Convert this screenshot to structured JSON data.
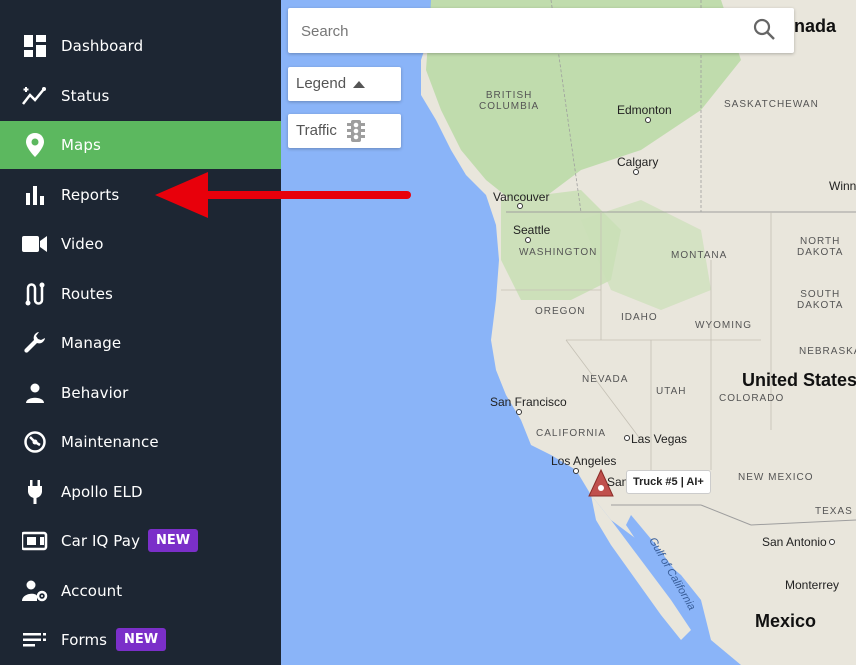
{
  "sidebar": {
    "items": [
      {
        "label": "Dashboard",
        "icon": "dashboard-icon",
        "active": false
      },
      {
        "label": "Status",
        "icon": "status-icon",
        "active": false
      },
      {
        "label": "Maps",
        "icon": "map-pin-icon",
        "active": true
      },
      {
        "label": "Reports",
        "icon": "bar-chart-icon",
        "active": false
      },
      {
        "label": "Video",
        "icon": "video-camera-icon",
        "active": false
      },
      {
        "label": "Routes",
        "icon": "routes-icon",
        "active": false
      },
      {
        "label": "Manage",
        "icon": "wrench-icon",
        "active": false
      },
      {
        "label": "Behavior",
        "icon": "person-icon",
        "active": false
      },
      {
        "label": "Maintenance",
        "icon": "maintenance-icon",
        "active": false
      },
      {
        "label": "Apollo ELD",
        "icon": "plug-icon",
        "active": false
      },
      {
        "label": "Car IQ Pay",
        "icon": "payment-icon",
        "active": false,
        "badge": "NEW"
      },
      {
        "label": "Account",
        "icon": "account-settings-icon",
        "active": false
      },
      {
        "label": "Forms",
        "icon": "forms-icon",
        "active": false,
        "badge": "NEW"
      }
    ]
  },
  "map": {
    "search_placeholder": "Search",
    "legend_label": "Legend",
    "traffic_label": "Traffic",
    "truck_label": "Truck #5 | AI+",
    "labels": {
      "canada": "nada",
      "british_columbia": "BRITISH\nCOLUMBIA",
      "edmonton": "Edmonton",
      "saskatchewan": "SASKATCHEWAN",
      "calgary": "Calgary",
      "winnipeg": "Winn",
      "vancouver": "Vancouver",
      "seattle": "Seattle",
      "washington": "WASHINGTON",
      "montana": "MONTANA",
      "north_dakota": "NORTH\nDAKOTA",
      "south_dakota": "SOUTH\nDAKOTA",
      "oregon": "OREGON",
      "idaho": "IDAHO",
      "wyoming": "WYOMING",
      "nebraska": "NEBRASKA",
      "nevada": "NEVADA",
      "utah": "UTAH",
      "united_states": "United States",
      "san_francisco": "San Francisco",
      "colorado": "COLORADO",
      "california": "CALIFORNIA",
      "las_vegas": "Las Vegas",
      "los_angeles": "Los Angeles",
      "san_diego": "San",
      "new_mexico": "NEW MEXICO",
      "texas": "TEXAS",
      "san_antonio": "San Antonio",
      "monterrey": "Monterrey",
      "gulf_of_california": "Gulf of California",
      "mexico": "Mexico"
    },
    "colors": {
      "ocean": "#8ab4f8",
      "land": "#e9e6dc",
      "forest": "#b9d9a4",
      "active_nav": "#5cb85f",
      "sidebar_bg": "#1d2633",
      "badge": "#7b2fc9",
      "arrow": "#e8000b"
    }
  }
}
